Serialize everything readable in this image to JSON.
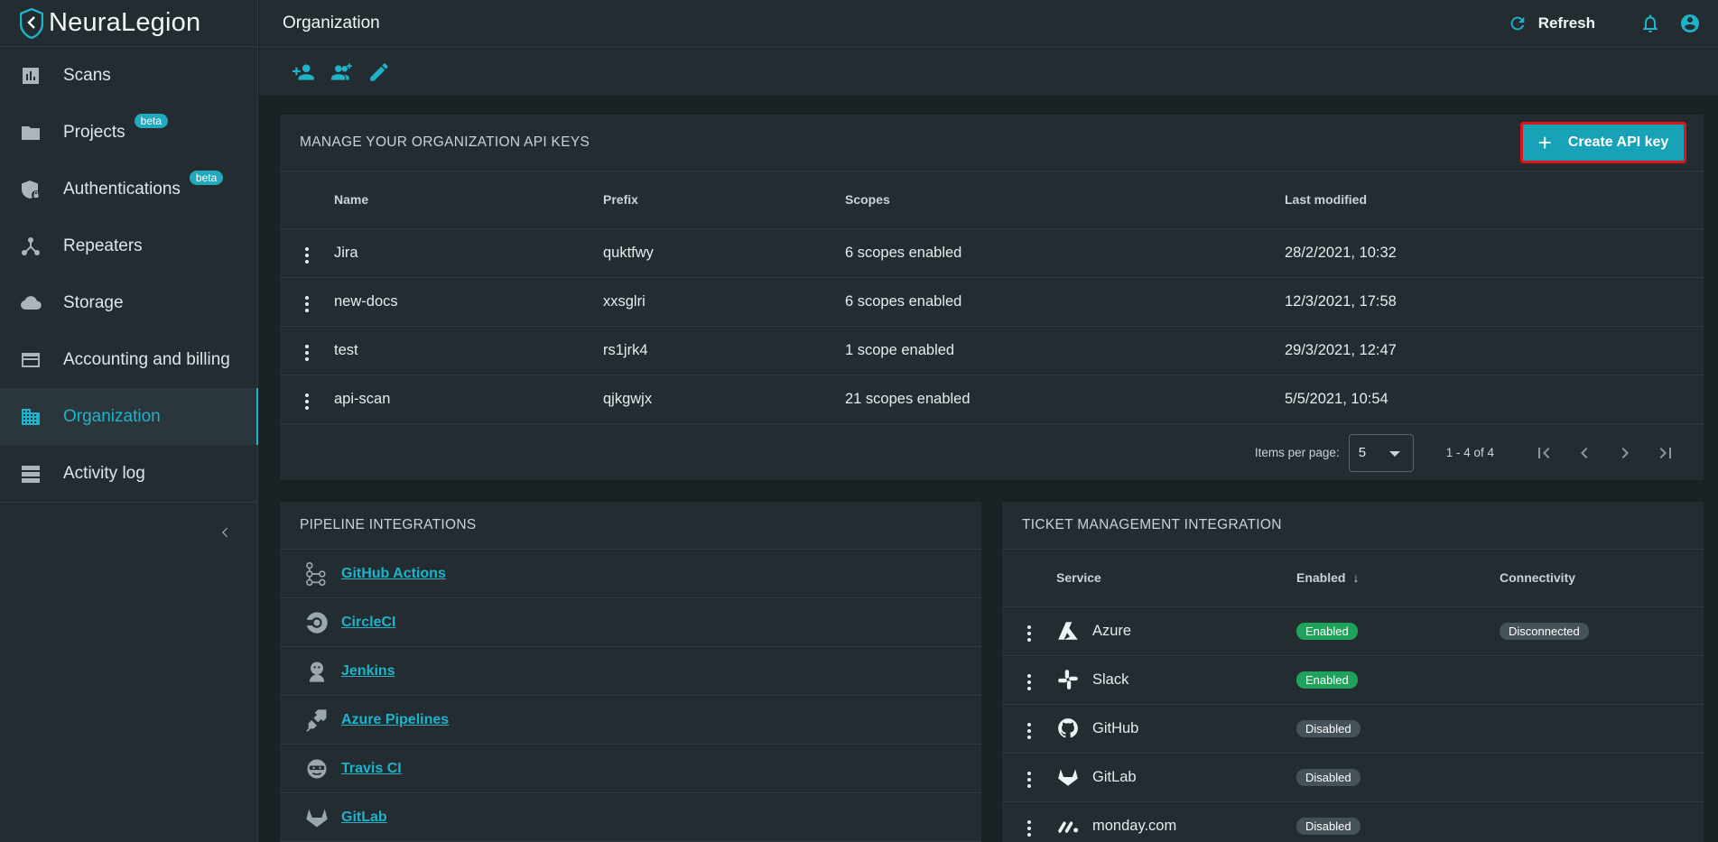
{
  "brand": {
    "name": "NeuraLegion"
  },
  "sidebar": {
    "items": [
      {
        "label": "Scans",
        "icon": "chart-icon",
        "beta": ""
      },
      {
        "label": "Projects",
        "icon": "folder-icon",
        "beta": "beta"
      },
      {
        "label": "Authentications",
        "icon": "shield-lock-icon",
        "beta": "beta"
      },
      {
        "label": "Repeaters",
        "icon": "hub-icon",
        "beta": ""
      },
      {
        "label": "Storage",
        "icon": "cloud-icon",
        "beta": ""
      },
      {
        "label": "Accounting and billing",
        "icon": "credit-card-icon",
        "beta": ""
      },
      {
        "label": "Organization",
        "icon": "building-icon",
        "beta": "",
        "active": true
      },
      {
        "label": "Activity log",
        "icon": "list-icon",
        "beta": ""
      }
    ]
  },
  "header": {
    "title": "Organization",
    "refresh_label": "Refresh"
  },
  "api_keys": {
    "title": "MANAGE YOUR ORGANIZATION API KEYS",
    "create_label": "Create API key",
    "columns": [
      "Name",
      "Prefix",
      "Scopes",
      "Last modified"
    ],
    "rows": [
      [
        "Jira",
        "quktfwy",
        "6 scopes enabled",
        "28/2/2021, 10:32"
      ],
      [
        "new-docs",
        "xxsglri",
        "6 scopes enabled",
        "12/3/2021, 17:58"
      ],
      [
        "test",
        "rs1jrk4",
        "1 scope enabled",
        "29/3/2021, 12:47"
      ],
      [
        "api-scan",
        "qjkgwjx",
        "21 scopes enabled",
        "5/5/2021, 10:54"
      ]
    ],
    "paginator": {
      "items_per_page_label": "Items per page:",
      "items_per_page": "5",
      "range": "1 - 4 of 4"
    }
  },
  "pipeline": {
    "title": "PIPELINE INTEGRATIONS",
    "items": [
      "GitHub Actions",
      "CircleCI",
      "Jenkins",
      "Azure Pipelines",
      "Travis CI",
      "GitLab"
    ]
  },
  "tickets": {
    "title": "TICKET MANAGEMENT INTEGRATION",
    "columns": [
      "Service",
      "Enabled",
      "Connectivity"
    ],
    "sort_arrow": "↓",
    "rows": [
      {
        "service": "Azure",
        "enabled": "Enabled",
        "connectivity": "Disconnected"
      },
      {
        "service": "Slack",
        "enabled": "Enabled",
        "connectivity": ""
      },
      {
        "service": "GitHub",
        "enabled": "Disabled",
        "connectivity": ""
      },
      {
        "service": "GitLab",
        "enabled": "Disabled",
        "connectivity": ""
      },
      {
        "service": "monday.com",
        "enabled": "Disabled",
        "connectivity": ""
      }
    ]
  },
  "colors": {
    "accent": "#1fb3c9",
    "enabled": "#1fa35a",
    "disabled": "#465259",
    "highlight": "#e1141a"
  }
}
